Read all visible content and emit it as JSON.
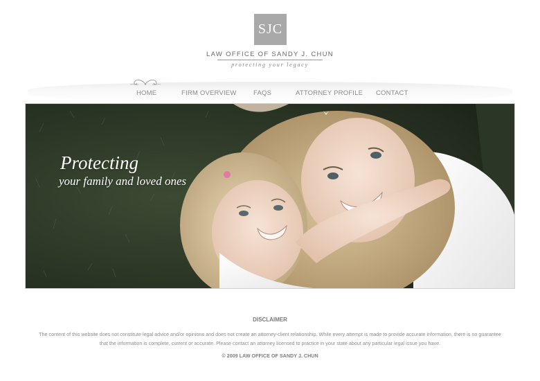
{
  "header": {
    "logo_monogram": "SJC",
    "firm_name": "LAW OFFICE OF SANDY J. CHUN",
    "tagline": "protecting your legacy"
  },
  "nav": {
    "items": [
      {
        "label": "HOME"
      },
      {
        "label": "FIRM OVERVIEW"
      },
      {
        "label": "FAQS"
      },
      {
        "label": "ATTORNEY PROFILE"
      },
      {
        "label": "CONTACT"
      }
    ]
  },
  "hero": {
    "title": "Protecting",
    "subtitle": "your family and loved ones"
  },
  "footer": {
    "disclaimer_title": "DISCLAIMER",
    "disclaimer_text": "The content of this website does not constitute legal advice and/or opinions and does not create an attorney-client relationship. While every attempt is made to provide accurate information, there is no guarantee that the information is complete, current or accurate. Please contact an attorney licensed to practice in your state about any particular legal issue you have.",
    "copyright": "© 2009 LAW OFFICE OF SANDY J. CHUN"
  },
  "colors": {
    "logo_box": "#a9a9a9",
    "nav_text": "#8a8a8a",
    "grass": "#2b3a25"
  }
}
